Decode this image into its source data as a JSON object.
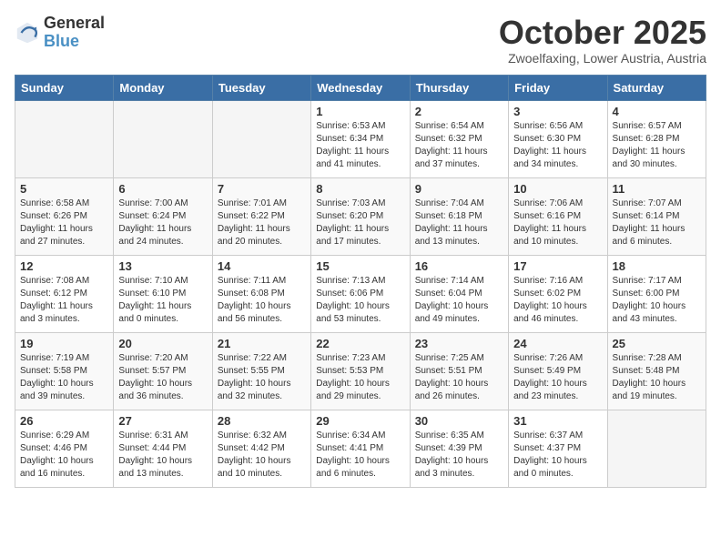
{
  "logo": {
    "general": "General",
    "blue": "Blue"
  },
  "header": {
    "month": "October 2025",
    "location": "Zwoelfaxing, Lower Austria, Austria"
  },
  "weekdays": [
    "Sunday",
    "Monday",
    "Tuesday",
    "Wednesday",
    "Thursday",
    "Friday",
    "Saturday"
  ],
  "weeks": [
    [
      {
        "day": "",
        "info": ""
      },
      {
        "day": "",
        "info": ""
      },
      {
        "day": "",
        "info": ""
      },
      {
        "day": "1",
        "info": "Sunrise: 6:53 AM\nSunset: 6:34 PM\nDaylight: 11 hours\nand 41 minutes."
      },
      {
        "day": "2",
        "info": "Sunrise: 6:54 AM\nSunset: 6:32 PM\nDaylight: 11 hours\nand 37 minutes."
      },
      {
        "day": "3",
        "info": "Sunrise: 6:56 AM\nSunset: 6:30 PM\nDaylight: 11 hours\nand 34 minutes."
      },
      {
        "day": "4",
        "info": "Sunrise: 6:57 AM\nSunset: 6:28 PM\nDaylight: 11 hours\nand 30 minutes."
      }
    ],
    [
      {
        "day": "5",
        "info": "Sunrise: 6:58 AM\nSunset: 6:26 PM\nDaylight: 11 hours\nand 27 minutes."
      },
      {
        "day": "6",
        "info": "Sunrise: 7:00 AM\nSunset: 6:24 PM\nDaylight: 11 hours\nand 24 minutes."
      },
      {
        "day": "7",
        "info": "Sunrise: 7:01 AM\nSunset: 6:22 PM\nDaylight: 11 hours\nand 20 minutes."
      },
      {
        "day": "8",
        "info": "Sunrise: 7:03 AM\nSunset: 6:20 PM\nDaylight: 11 hours\nand 17 minutes."
      },
      {
        "day": "9",
        "info": "Sunrise: 7:04 AM\nSunset: 6:18 PM\nDaylight: 11 hours\nand 13 minutes."
      },
      {
        "day": "10",
        "info": "Sunrise: 7:06 AM\nSunset: 6:16 PM\nDaylight: 11 hours\nand 10 minutes."
      },
      {
        "day": "11",
        "info": "Sunrise: 7:07 AM\nSunset: 6:14 PM\nDaylight: 11 hours\nand 6 minutes."
      }
    ],
    [
      {
        "day": "12",
        "info": "Sunrise: 7:08 AM\nSunset: 6:12 PM\nDaylight: 11 hours\nand 3 minutes."
      },
      {
        "day": "13",
        "info": "Sunrise: 7:10 AM\nSunset: 6:10 PM\nDaylight: 11 hours\nand 0 minutes."
      },
      {
        "day": "14",
        "info": "Sunrise: 7:11 AM\nSunset: 6:08 PM\nDaylight: 10 hours\nand 56 minutes."
      },
      {
        "day": "15",
        "info": "Sunrise: 7:13 AM\nSunset: 6:06 PM\nDaylight: 10 hours\nand 53 minutes."
      },
      {
        "day": "16",
        "info": "Sunrise: 7:14 AM\nSunset: 6:04 PM\nDaylight: 10 hours\nand 49 minutes."
      },
      {
        "day": "17",
        "info": "Sunrise: 7:16 AM\nSunset: 6:02 PM\nDaylight: 10 hours\nand 46 minutes."
      },
      {
        "day": "18",
        "info": "Sunrise: 7:17 AM\nSunset: 6:00 PM\nDaylight: 10 hours\nand 43 minutes."
      }
    ],
    [
      {
        "day": "19",
        "info": "Sunrise: 7:19 AM\nSunset: 5:58 PM\nDaylight: 10 hours\nand 39 minutes."
      },
      {
        "day": "20",
        "info": "Sunrise: 7:20 AM\nSunset: 5:57 PM\nDaylight: 10 hours\nand 36 minutes."
      },
      {
        "day": "21",
        "info": "Sunrise: 7:22 AM\nSunset: 5:55 PM\nDaylight: 10 hours\nand 32 minutes."
      },
      {
        "day": "22",
        "info": "Sunrise: 7:23 AM\nSunset: 5:53 PM\nDaylight: 10 hours\nand 29 minutes."
      },
      {
        "day": "23",
        "info": "Sunrise: 7:25 AM\nSunset: 5:51 PM\nDaylight: 10 hours\nand 26 minutes."
      },
      {
        "day": "24",
        "info": "Sunrise: 7:26 AM\nSunset: 5:49 PM\nDaylight: 10 hours\nand 23 minutes."
      },
      {
        "day": "25",
        "info": "Sunrise: 7:28 AM\nSunset: 5:48 PM\nDaylight: 10 hours\nand 19 minutes."
      }
    ],
    [
      {
        "day": "26",
        "info": "Sunrise: 6:29 AM\nSunset: 4:46 PM\nDaylight: 10 hours\nand 16 minutes."
      },
      {
        "day": "27",
        "info": "Sunrise: 6:31 AM\nSunset: 4:44 PM\nDaylight: 10 hours\nand 13 minutes."
      },
      {
        "day": "28",
        "info": "Sunrise: 6:32 AM\nSunset: 4:42 PM\nDaylight: 10 hours\nand 10 minutes."
      },
      {
        "day": "29",
        "info": "Sunrise: 6:34 AM\nSunset: 4:41 PM\nDaylight: 10 hours\nand 6 minutes."
      },
      {
        "day": "30",
        "info": "Sunrise: 6:35 AM\nSunset: 4:39 PM\nDaylight: 10 hours\nand 3 minutes."
      },
      {
        "day": "31",
        "info": "Sunrise: 6:37 AM\nSunset: 4:37 PM\nDaylight: 10 hours\nand 0 minutes."
      },
      {
        "day": "",
        "info": ""
      }
    ]
  ]
}
